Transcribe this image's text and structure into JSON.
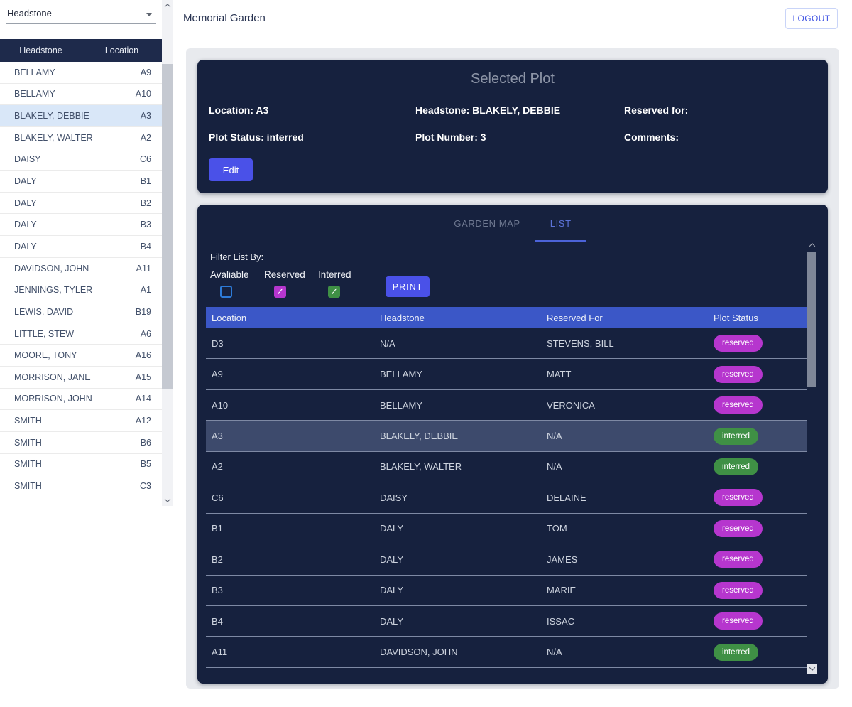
{
  "colors": {
    "accent_blue": "#4a51e8",
    "table_header_blue": "#3b57c7",
    "card_bg": "#16213e",
    "selected_row_bg": "#3d4a6c",
    "sidebar_selected_bg": "#d9e7f8",
    "tab_active": "#5c73d8",
    "reserved_badge": "#b636ce",
    "interred_badge": "#3f9045",
    "available_checkbox": "#2d7bd8"
  },
  "sidebar": {
    "dropdown": {
      "value": "Headstone"
    },
    "table": {
      "headers": [
        "Headstone",
        "Location"
      ],
      "selected_index": 2,
      "rows": [
        [
          "BELLAMY",
          "A9"
        ],
        [
          "BELLAMY",
          "A10"
        ],
        [
          "BLAKELY, DEBBIE",
          "A3"
        ],
        [
          "BLAKELY, WALTER",
          "A2"
        ],
        [
          "DAISY",
          "C6"
        ],
        [
          "DALY",
          "B1"
        ],
        [
          "DALY",
          "B2"
        ],
        [
          "DALY",
          "B3"
        ],
        [
          "DALY",
          "B4"
        ],
        [
          "DAVIDSON, JOHN",
          "A11"
        ],
        [
          "JENNINGS, TYLER",
          "A1"
        ],
        [
          "LEWIS, DAVID",
          "B19"
        ],
        [
          "LITTLE, STEW",
          "A6"
        ],
        [
          "MOORE, TONY",
          "A16"
        ],
        [
          "MORRISON, JANE",
          "A15"
        ],
        [
          "MORRISON, JOHN",
          "A14"
        ],
        [
          "SMITH",
          "A12"
        ],
        [
          "SMITH",
          "B6"
        ],
        [
          "SMITH",
          "B5"
        ],
        [
          "SMITH",
          "C3"
        ]
      ]
    }
  },
  "header": {
    "title": "Memorial Garden",
    "logout_label": "LOGOUT"
  },
  "selected_plot": {
    "title": "Selected Plot",
    "fields": [
      "Location: A3",
      "Headstone: BLAKELY, DEBBIE",
      "Reserved for:",
      "Plot Status: interred",
      "Plot Number: 3",
      "Comments:"
    ],
    "edit_label": "Edit"
  },
  "plots": {
    "tabs": [
      {
        "label": "GARDEN MAP",
        "active": false
      },
      {
        "label": "LIST",
        "active": true
      }
    ],
    "filter_title": "Filter List By:",
    "filter_options": [
      {
        "label": "Avaliable",
        "checked": false,
        "color": "#2d7bd8"
      },
      {
        "label": "Reserved",
        "checked": true,
        "color": "#b636ce"
      },
      {
        "label": "Interred",
        "checked": true,
        "color": "#3f9045"
      }
    ],
    "print_label": "PRINT",
    "table": {
      "headers": [
        "Location",
        "Headstone",
        "Reserved For",
        "Plot Status"
      ],
      "selected_location": "A3",
      "status_colors": {
        "reserved": "#b636ce",
        "interred": "#3f9045"
      },
      "rows": [
        {
          "location": "D3",
          "headstone": "N/A",
          "reserved_for": "STEVENS, BILL",
          "status": "reserved"
        },
        {
          "location": "A9",
          "headstone": "BELLAMY",
          "reserved_for": "MATT",
          "status": "reserved"
        },
        {
          "location": "A10",
          "headstone": "BELLAMY",
          "reserved_for": "VERONICA",
          "status": "reserved"
        },
        {
          "location": "A3",
          "headstone": "BLAKELY, DEBBIE",
          "reserved_for": "N/A",
          "status": "interred"
        },
        {
          "location": "A2",
          "headstone": "BLAKELY, WALTER",
          "reserved_for": "N/A",
          "status": "interred"
        },
        {
          "location": "C6",
          "headstone": "DAISY",
          "reserved_for": "DELAINE",
          "status": "reserved"
        },
        {
          "location": "B1",
          "headstone": "DALY",
          "reserved_for": "TOM",
          "status": "reserved"
        },
        {
          "location": "B2",
          "headstone": "DALY",
          "reserved_for": "JAMES",
          "status": "reserved"
        },
        {
          "location": "B3",
          "headstone": "DALY",
          "reserved_for": "MARIE",
          "status": "reserved"
        },
        {
          "location": "B4",
          "headstone": "DALY",
          "reserved_for": "ISSAC",
          "status": "reserved"
        },
        {
          "location": "A11",
          "headstone": "DAVIDSON, JOHN",
          "reserved_for": "N/A",
          "status": "interred"
        }
      ]
    }
  }
}
